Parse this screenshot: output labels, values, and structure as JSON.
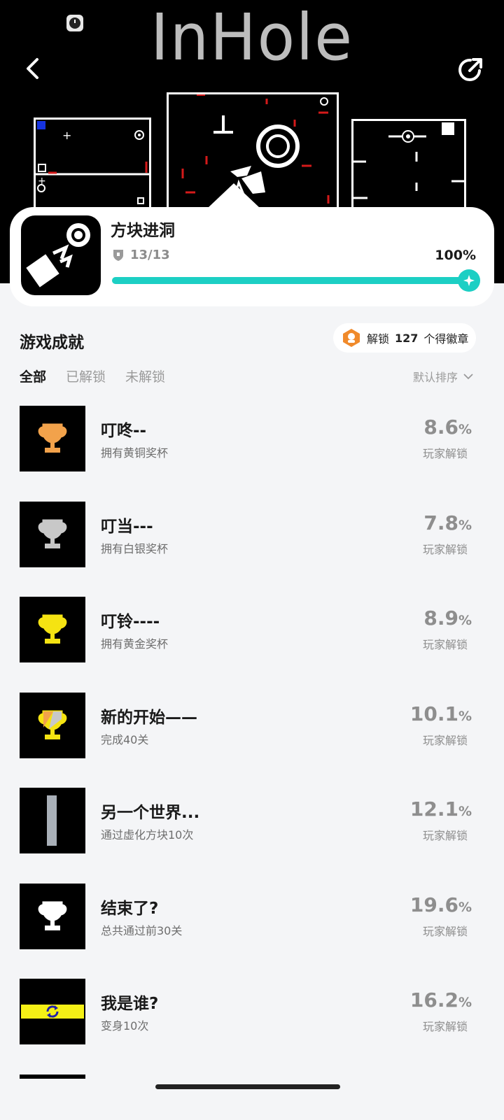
{
  "hero": {
    "title": "InHole",
    "back_icon": "chevron-left-icon",
    "share_icon": "share-icon"
  },
  "game": {
    "name": "方块进洞",
    "trophies": "13/13",
    "progress_percent": "100%",
    "progress_value": 1.0,
    "accent": "#1ccfc4"
  },
  "section": {
    "title": "游戏成就",
    "badge_prefix": "解锁",
    "badge_count": "127",
    "badge_suffix": "个得徽章"
  },
  "tabs": [
    "全部",
    "已解锁",
    "未解锁"
  ],
  "active_tab": 0,
  "sort_label": "默认排序",
  "achievements": [
    {
      "title": "叮咚--",
      "desc": "拥有黄铜奖杯",
      "rate": "8.6",
      "unlock": "玩家解锁",
      "icon": "bronze-trophy-icon"
    },
    {
      "title": "叮当---",
      "desc": "拥有白银奖杯",
      "rate": "7.8",
      "unlock": "玩家解锁",
      "icon": "silver-trophy-icon"
    },
    {
      "title": "叮铃----",
      "desc": "拥有黄金奖杯",
      "rate": "8.9",
      "unlock": "玩家解锁",
      "icon": "gold-trophy-icon"
    },
    {
      "title": "新的开始——",
      "desc": "完成40关",
      "rate": "10.1",
      "unlock": "玩家解锁",
      "icon": "mixed-trophy-icon"
    },
    {
      "title": "另一个世界...",
      "desc": "通过虚化方块10次",
      "rate": "12.1",
      "unlock": "玩家解锁",
      "icon": "grey-bar-icon"
    },
    {
      "title": "结束了?",
      "desc": "总共通过前30关",
      "rate": "19.6",
      "unlock": "玩家解锁",
      "icon": "white-trophy-icon"
    },
    {
      "title": "我是谁?",
      "desc": "变身10次",
      "rate": "16.2",
      "unlock": "玩家解锁",
      "icon": "transform-icon"
    }
  ],
  "pct_sign": "%"
}
